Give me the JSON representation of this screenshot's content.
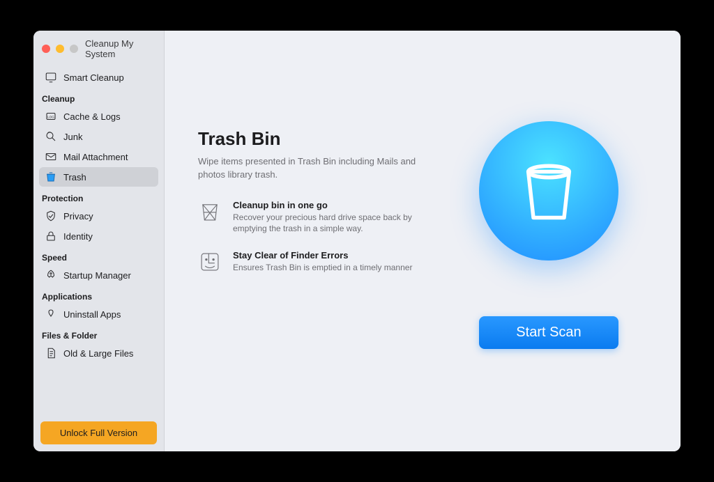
{
  "app": {
    "title": "Cleanup My System"
  },
  "sidebar": {
    "top": {
      "smart_cleanup": "Smart Cleanup"
    },
    "sections": [
      {
        "header": "Cleanup",
        "items": [
          {
            "label": "Cache & Logs",
            "icon": "log-icon"
          },
          {
            "label": "Junk",
            "icon": "magnifier-icon"
          },
          {
            "label": "Mail Attachment",
            "icon": "envelope-icon"
          },
          {
            "label": "Trash",
            "icon": "trash-icon",
            "selected": true
          }
        ]
      },
      {
        "header": "Protection",
        "items": [
          {
            "label": "Privacy",
            "icon": "shield-icon"
          },
          {
            "label": "Identity",
            "icon": "lock-icon"
          }
        ]
      },
      {
        "header": "Speed",
        "items": [
          {
            "label": "Startup Manager",
            "icon": "rocket-icon"
          }
        ]
      },
      {
        "header": "Applications",
        "items": [
          {
            "label": "Uninstall Apps",
            "icon": "app-icon"
          }
        ]
      },
      {
        "header": "Files & Folder",
        "items": [
          {
            "label": "Old & Large Files",
            "icon": "file-icon"
          }
        ]
      }
    ],
    "unlock_label": "Unlock Full Version"
  },
  "main": {
    "title": "Trash Bin",
    "description": "Wipe items presented in Trash Bin including Mails and photos library trash.",
    "features": [
      {
        "title": "Cleanup bin in one go",
        "desc": "Recover your precious hard drive space back by emptying the trash in a simple way."
      },
      {
        "title": "Stay Clear of Finder Errors",
        "desc": "Ensures Trash Bin is emptied in a timely manner"
      }
    ],
    "start_label": "Start Scan"
  }
}
